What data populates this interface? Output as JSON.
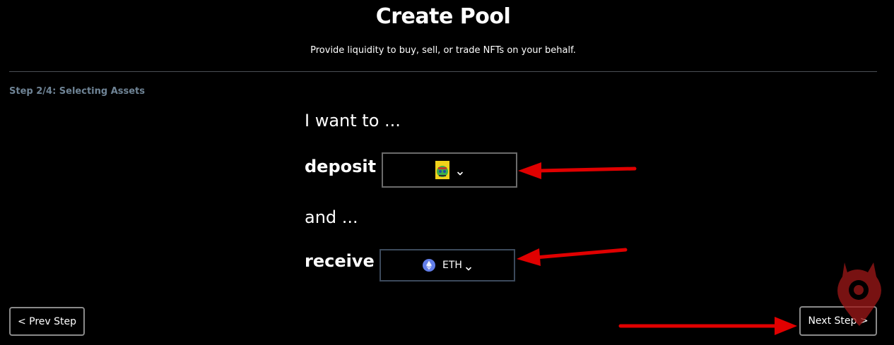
{
  "header": {
    "title": "Create Pool",
    "subtitle": "Provide liquidity to buy, sell, or trade NFTs on your behalf."
  },
  "step": {
    "label": "Step 2/4: Selecting Assets"
  },
  "form": {
    "intro": "I want to ...",
    "deposit_label": "deposit",
    "and_text": "and ...",
    "receive_label": "receive",
    "deposit_select": {
      "icon": "nft-collection-icon"
    },
    "receive_select": {
      "icon": "ethereum-icon",
      "value": "ETH"
    }
  },
  "nav": {
    "prev_label": "< Prev Step",
    "next_label": "Next Step >"
  },
  "annotations": {
    "arrow_color": "#e00000"
  }
}
